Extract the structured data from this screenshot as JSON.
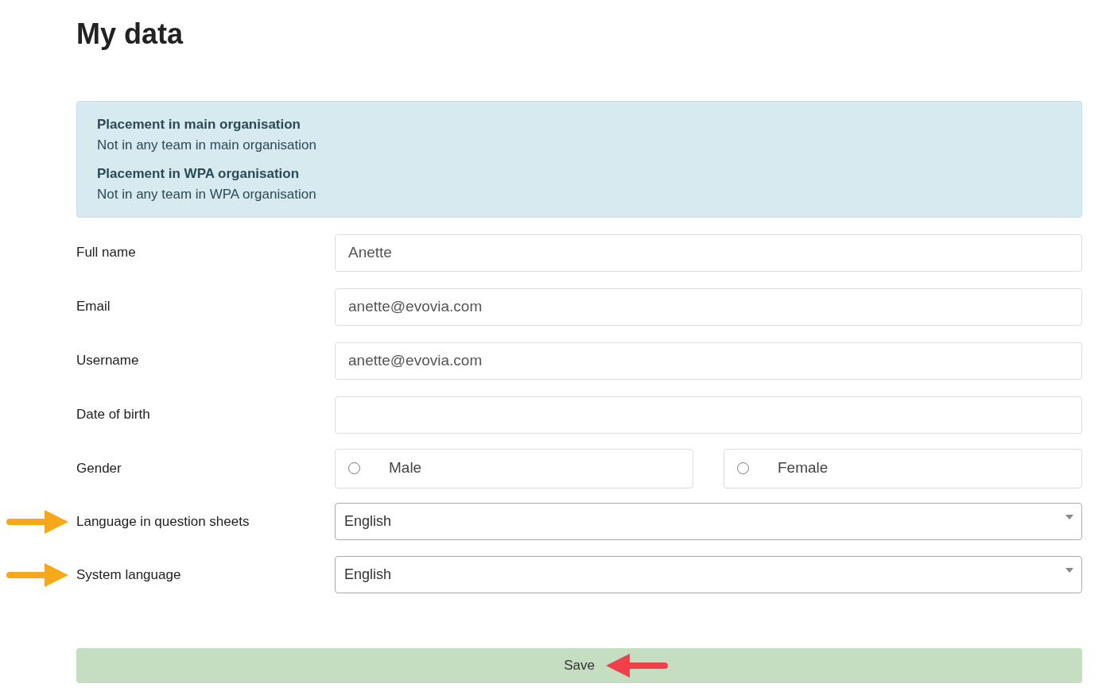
{
  "title": "My data",
  "info": [
    {
      "heading": "Placement in main organisation",
      "text": "Not in any team in main organisation"
    },
    {
      "heading": "Placement in WPA organisation",
      "text": "Not in any team in WPA organisation"
    }
  ],
  "fields": [
    {
      "kind": "text",
      "label": "Full name",
      "value": "Anette",
      "arrow": false
    },
    {
      "kind": "text",
      "label": "Email",
      "value": "anette@evovia.com",
      "arrow": false
    },
    {
      "kind": "text",
      "label": "Username",
      "value": "anette@evovia.com",
      "arrow": false
    },
    {
      "kind": "text",
      "label": "Date of birth",
      "arrow": false
    },
    {
      "kind": "radio",
      "label": "Gender",
      "options": [
        {
          "label": "Male",
          "selected": false
        },
        {
          "label": "Female",
          "selected": false
        }
      ],
      "arrow": false
    },
    {
      "kind": "select",
      "label": "Language in question sheets",
      "value": "English",
      "arrow": true
    },
    {
      "kind": "select",
      "label": "System language",
      "value": "English",
      "arrow": true
    }
  ],
  "save": {
    "label": "Save",
    "arrow": true
  }
}
